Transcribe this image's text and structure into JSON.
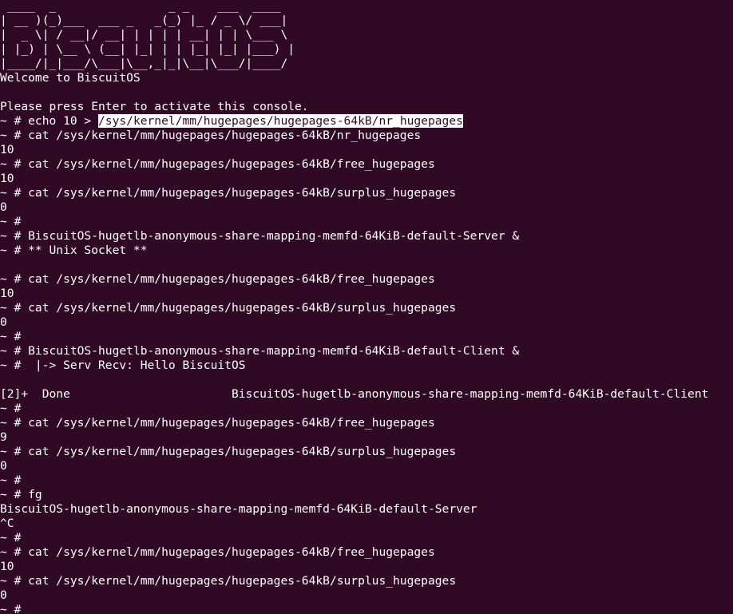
{
  "terminal": {
    "background": "#300a24",
    "foreground": "#ffffff",
    "selection_background": "#ffffff",
    "lines": [
      {
        "text": " ____  _                _ _    ___  ____  "
      },
      {
        "text": "| __ )(_)___  ___ _   _(_) |_ / _ \\/ ___| "
      },
      {
        "text": "|  _ \\| / __|/ __| | | | | __| | | \\___ \\ "
      },
      {
        "text": "| |_) | \\__ \\ (__| |_| | | |_| |_| |___) |"
      },
      {
        "text": "|____/|_|___/\\___|\\__,_|_|\\__|\\___/|____/ "
      },
      {
        "text": "Welcome to BiscuitOS"
      },
      {
        "text": ""
      },
      {
        "text": "Please press Enter to activate this console."
      },
      {
        "text": "~ # echo 10 > ",
        "highlight": "/sys/kernel/mm/hugepages/hugepages-64kB/nr_hugepages"
      },
      {
        "text": "~ # cat /sys/kernel/mm/hugepages/hugepages-64kB/nr_hugepages"
      },
      {
        "text": "10"
      },
      {
        "text": "~ # cat /sys/kernel/mm/hugepages/hugepages-64kB/free_hugepages"
      },
      {
        "text": "10"
      },
      {
        "text": "~ # cat /sys/kernel/mm/hugepages/hugepages-64kB/surplus_hugepages"
      },
      {
        "text": "0"
      },
      {
        "text": "~ #"
      },
      {
        "text": "~ # BiscuitOS-hugetlb-anonymous-share-mapping-memfd-64KiB-default-Server &"
      },
      {
        "text": "~ # ** Unix Socket **"
      },
      {
        "text": ""
      },
      {
        "text": "~ # cat /sys/kernel/mm/hugepages/hugepages-64kB/free_hugepages"
      },
      {
        "text": "10"
      },
      {
        "text": "~ # cat /sys/kernel/mm/hugepages/hugepages-64kB/surplus_hugepages"
      },
      {
        "text": "0"
      },
      {
        "text": "~ #"
      },
      {
        "text": "~ # BiscuitOS-hugetlb-anonymous-share-mapping-memfd-64KiB-default-Client &"
      },
      {
        "text": "~ #  |-> Serv Recv: Hello BiscuitOS"
      },
      {
        "text": ""
      },
      {
        "text": "[2]+  Done                       BiscuitOS-hugetlb-anonymous-share-mapping-memfd-64KiB-default-Client"
      },
      {
        "text": "~ #"
      },
      {
        "text": "~ # cat /sys/kernel/mm/hugepages/hugepages-64kB/free_hugepages"
      },
      {
        "text": "9"
      },
      {
        "text": "~ # cat /sys/kernel/mm/hugepages/hugepages-64kB/surplus_hugepages"
      },
      {
        "text": "0"
      },
      {
        "text": "~ #"
      },
      {
        "text": "~ # fg"
      },
      {
        "text": "BiscuitOS-hugetlb-anonymous-share-mapping-memfd-64KiB-default-Server"
      },
      {
        "text": "^C"
      },
      {
        "text": "~ #"
      },
      {
        "text": "~ # cat /sys/kernel/mm/hugepages/hugepages-64kB/free_hugepages"
      },
      {
        "text": "10"
      },
      {
        "text": "~ # cat /sys/kernel/mm/hugepages/hugepages-64kB/surplus_hugepages"
      },
      {
        "text": "0"
      },
      {
        "text": "~ #"
      }
    ]
  }
}
